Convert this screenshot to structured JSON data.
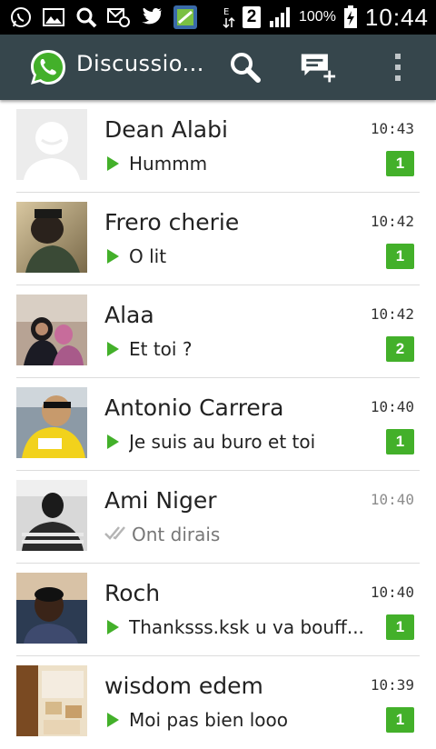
{
  "status_bar": {
    "icons": [
      "whatsapp-icon",
      "gallery-icon",
      "search-icon",
      "voicemail-icon",
      "twitter-icon",
      "app-icon",
      "data-transfer-icon",
      "sim-2-icon",
      "signal-icon"
    ],
    "sim_label": "2",
    "battery": "100%",
    "time": "10:44"
  },
  "action_bar": {
    "title": "Discussio...",
    "icons": [
      "search-icon",
      "new-chat-icon",
      "overflow-menu-icon"
    ],
    "bg_color": "#36464c"
  },
  "accent": "#43b02a",
  "chats": [
    {
      "name": "Dean Alabi",
      "time": "10:43",
      "message": "Hummm",
      "unread": "1",
      "status": "played"
    },
    {
      "name": "Frero cherie",
      "time": "10:42",
      "message": "O lit",
      "unread": "1",
      "status": "played"
    },
    {
      "name": "Alaa",
      "time": "10:42",
      "message": "Et toi ?",
      "unread": "2",
      "status": "played"
    },
    {
      "name": "Antonio Carrera",
      "time": "10:40",
      "message": "Je suis au buro et toi",
      "unread": "1",
      "status": "played"
    },
    {
      "name": "Ami Niger",
      "time": "10:40",
      "message": "Ont dirais",
      "unread": "",
      "status": "read"
    },
    {
      "name": "Roch",
      "time": "10:40",
      "message": "Thanksss.ksk u va bouff...",
      "unread": "1",
      "status": "played"
    },
    {
      "name": "wisdom edem",
      "time": "10:39",
      "message": "Moi pas bien looo",
      "unread": "1",
      "status": "played"
    }
  ]
}
